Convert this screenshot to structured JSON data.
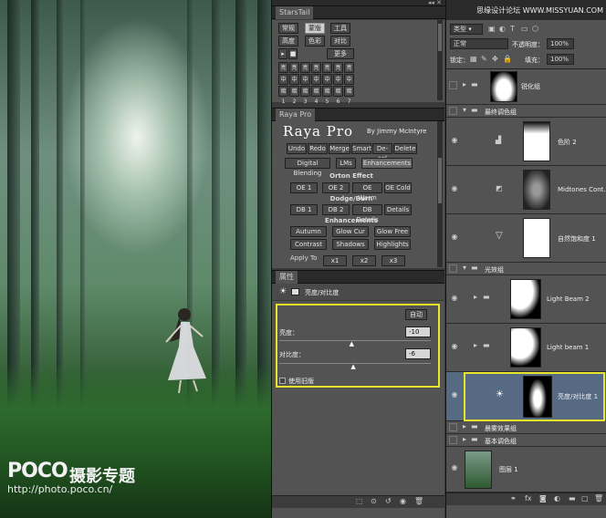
{
  "photo": {
    "logo": "POCO",
    "logo_cn": "摄影专题",
    "url": "http://photo.poco.cn/"
  },
  "watermark": "思缘设计论坛 WWW.MISSYUAN.COM",
  "starstail": {
    "tab": "StarsTail",
    "rows": [
      [
        "常规",
        "蒙版",
        "工具"
      ],
      [
        "高度",
        "色彩",
        "对比"
      ]
    ],
    "more": "更多",
    "grid": [
      [
        "亮1",
        "亮2",
        "亮3",
        "亮4",
        "亮5",
        "亮6",
        "亮7"
      ],
      [
        "中1",
        "中2",
        "中3",
        "中4",
        "中5",
        "中6",
        "中7"
      ],
      [
        "暗1",
        "暗2",
        "暗3",
        "暗4",
        "暗5",
        "暗6",
        "暗7"
      ]
    ]
  },
  "raya": {
    "tab": "Raya Pro",
    "title": "Raya Pro",
    "by": "By Jimmy McIntyre",
    "row1": [
      "Undo",
      "Redo",
      "Merge",
      "Smart",
      "De-sel",
      "Delete"
    ],
    "tabs": [
      "Digital Blending",
      "LMs",
      "Enhancements"
    ],
    "orton_hdr": "Orton Effect",
    "orton": [
      "OE 1",
      "OE 2",
      "OE Warm",
      "OE Cold"
    ],
    "dodge_hdr": "Dodge/Burn",
    "dodge": [
      "DB 1",
      "DB 2",
      "DB Details",
      "Details"
    ],
    "enh_hdr": "Enhancements",
    "enh1": [
      "Autumn",
      "Glow Cur",
      "Glow Free"
    ],
    "enh2": [
      "Contrast",
      "Shadows",
      "Highlights"
    ],
    "apply": "Apply To",
    "apply_btns": [
      "x1",
      "x2",
      "x3"
    ]
  },
  "properties": {
    "tab": "属性",
    "title": "亮度/对比度",
    "auto": "自动",
    "brightness_label": "亮度：",
    "brightness_value": "-10",
    "contrast_label": "对比度：",
    "contrast_value": "-6",
    "legacy_label": "使用旧版",
    "brightness_slider": 0.48,
    "contrast_slider": 0.49
  },
  "layers": {
    "kind": "类型",
    "blend": "正常",
    "opacity_label": "不透明度：",
    "opacity": "100%",
    "lock_label": "锁定：",
    "fill_label": "填充：",
    "fill": "100%",
    "items": [
      {
        "name": "锐化组"
      },
      {
        "name": "最终调色组"
      },
      {
        "name": "色阶 2"
      },
      {
        "name": "Midtones Cont..."
      },
      {
        "name": "自然饱和度 1"
      },
      {
        "name": "光效组"
      },
      {
        "name": "Light Beam 2"
      },
      {
        "name": "Light beam 1"
      },
      {
        "name": "亮度/对比度 1"
      },
      {
        "name": "晨雾效果组"
      },
      {
        "name": "基本调色组"
      },
      {
        "name": "图层 1"
      }
    ]
  },
  "colors": {
    "highlight": "#e8e629",
    "selected": "#566a84"
  }
}
